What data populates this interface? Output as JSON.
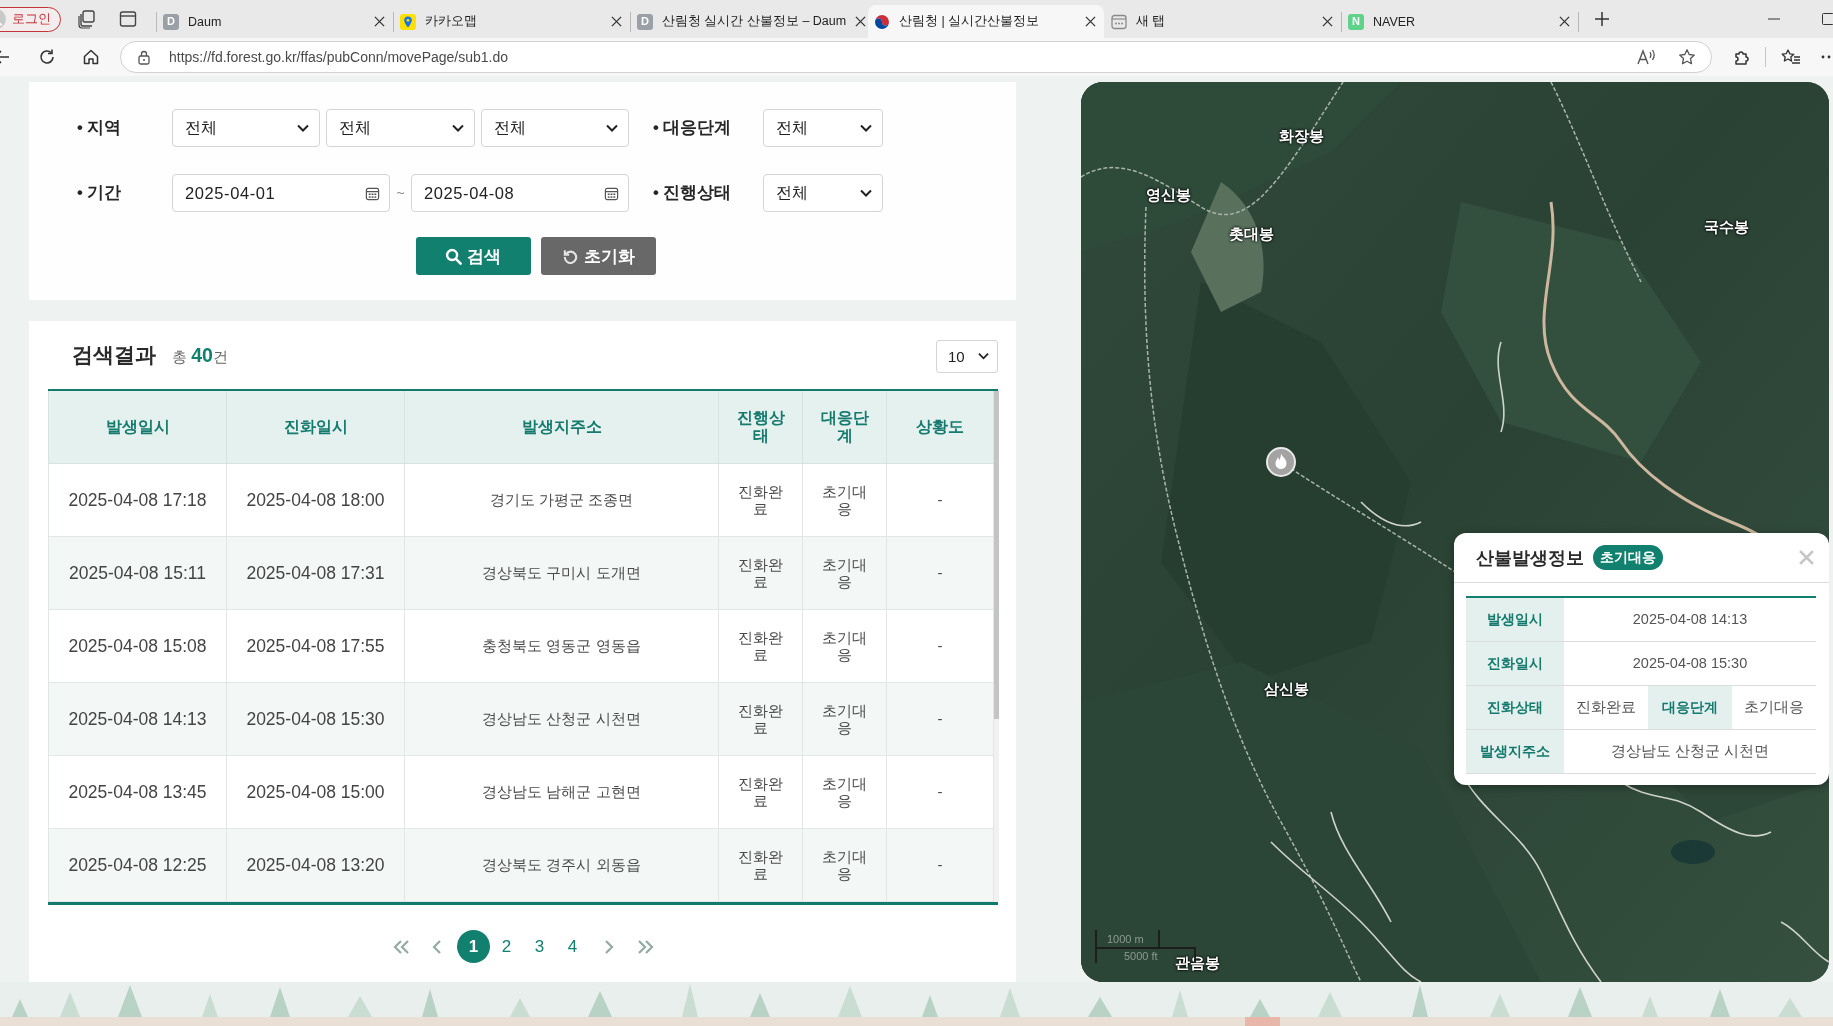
{
  "browser": {
    "profile": "로그인",
    "tabs": [
      {
        "title": "Daum",
        "icon": {
          "kind": "letter",
          "letter": "D",
          "color": "#9aa0a6"
        },
        "selected": false
      },
      {
        "title": "카카오맵",
        "icon": {
          "kind": "pin"
        },
        "selected": false
      },
      {
        "title": "산림청 실시간 산불정보 – Daum",
        "icon": {
          "kind": "letter",
          "letter": "D",
          "color": "#9aa0a6"
        },
        "selected": false
      },
      {
        "title": "산림청 | 실시간산불정보",
        "icon": {
          "kind": "emblem"
        },
        "selected": true
      },
      {
        "title": "새 탭",
        "icon": {
          "kind": "page"
        },
        "selected": false
      },
      {
        "title": "NAVER",
        "icon": {
          "kind": "letter",
          "letter": "N",
          "color": "#5fd38a"
        },
        "selected": false
      }
    ],
    "address": "https://fd.forest.go.kr/ffas/pubConn/movePage/sub1.do"
  },
  "search_form": {
    "filters": [
      {
        "label": "• 지역",
        "controls": [
          {
            "kind": "select",
            "value": "전체"
          },
          {
            "kind": "select",
            "value": "전체"
          },
          {
            "kind": "select",
            "value": "전체"
          }
        ]
      },
      {
        "label": "• 대응단계",
        "controls": [
          {
            "kind": "select",
            "value": "전체"
          }
        ]
      },
      {
        "label": "• 기간",
        "controls": [
          {
            "kind": "date",
            "value": "2025-04-01"
          },
          {
            "kind": "separator",
            "text": "~"
          },
          {
            "kind": "date",
            "value": "2025-04-08"
          }
        ]
      },
      {
        "label": "• 진행상태",
        "controls": [
          {
            "kind": "select",
            "value": "전체"
          }
        ]
      }
    ],
    "buttons": [
      {
        "kind": "search",
        "label": "검색"
      },
      {
        "kind": "reset",
        "label": "초기화"
      }
    ]
  },
  "results": {
    "title": "검색결과",
    "total": "총 **40**건",
    "page_size": "10",
    "columns": [
      "발생일시",
      "진화일시",
      "발생지주소",
      "진행상태",
      "대응단계",
      "상황도"
    ],
    "rows": [
      [
        "2025-04-08 17:18",
        "2025-04-08 18:00",
        "경기도 가평군 조종면",
        "진화완료",
        "초기대응",
        "-"
      ],
      [
        "2025-04-08 15:11",
        "2025-04-08 17:31",
        "경상북도 구미시 도개면",
        "진화완료",
        "초기대응",
        "-"
      ],
      [
        "2025-04-08 15:08",
        "2025-04-08 17:55",
        "충청북도 영동군 영동읍",
        "진화완료",
        "초기대응",
        "-"
      ],
      [
        "2025-04-08 14:13",
        "2025-04-08 15:30",
        "경상남도 산청군 시천면",
        "진화완료",
        "초기대응",
        "-"
      ],
      [
        "2025-04-08 13:45",
        "2025-04-08 15:00",
        "경상남도 남해군 고현면",
        "진화완료",
        "초기대응",
        "-"
      ],
      [
        "2025-04-08 12:25",
        "2025-04-08 13:20",
        "경상북도 경주시 외동읍",
        "진화완료",
        "초기대응",
        "-"
      ]
    ],
    "pagination": {
      "pages": [
        {
          "label": "1",
          "selected": true
        },
        {
          "label": "2",
          "selected": false
        },
        {
          "label": "3",
          "selected": false
        },
        {
          "label": "4",
          "selected": false
        }
      ]
    }
  },
  "map": {
    "place_labels": [
      "화장봉",
      "영신봉",
      "촛대봉",
      "국수봉",
      "삼신봉",
      "관음봉"
    ],
    "scale_labels": [
      "1000 m",
      "5000 ft"
    ],
    "popup": {
      "title": "산불발생정보",
      "badge": "초기대응",
      "rows": [
        {
          "cells": [
            {
              "label": "발생일시",
              "value": "2025-04-08 14:13"
            }
          ]
        },
        {
          "cells": [
            {
              "label": "진화일시",
              "value": "2025-04-08 15:30"
            }
          ]
        },
        {
          "cells": [
            {
              "label": "진화상태",
              "value": "진화완료"
            },
            {
              "label": "대응단계",
              "value": "초기대응"
            }
          ]
        },
        {
          "cells": [
            {
              "label": "발생지주소",
              "value": "경상남도 산청군 시천면"
            }
          ]
        }
      ]
    }
  }
}
